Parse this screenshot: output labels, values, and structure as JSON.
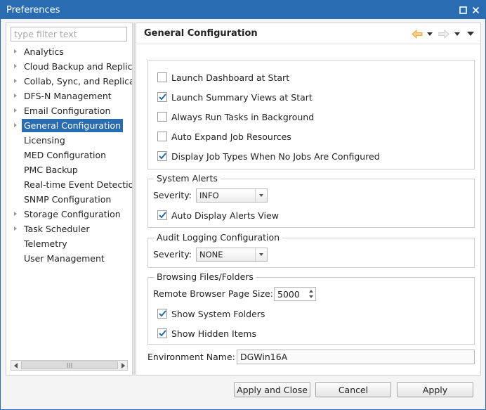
{
  "window": {
    "title": "Preferences"
  },
  "filter": {
    "placeholder": "type filter text",
    "value": ""
  },
  "tree": {
    "items": [
      {
        "label": "Analytics",
        "has_children": true
      },
      {
        "label": "Cloud Backup and Replic",
        "has_children": true
      },
      {
        "label": "Collab, Sync, and Replica",
        "has_children": true
      },
      {
        "label": "DFS-N Management",
        "has_children": true
      },
      {
        "label": "Email Configuration",
        "has_children": true
      },
      {
        "label": "General Configuration",
        "has_children": true,
        "selected": true
      },
      {
        "label": "Licensing",
        "has_children": false
      },
      {
        "label": "MED Configuration",
        "has_children": false
      },
      {
        "label": "PMC Backup",
        "has_children": false
      },
      {
        "label": "Real-time Event Detectio",
        "has_children": false
      },
      {
        "label": "SNMP Configuration",
        "has_children": false
      },
      {
        "label": "Storage Configuration",
        "has_children": true
      },
      {
        "label": "Task Scheduler",
        "has_children": true
      },
      {
        "label": "Telemetry",
        "has_children": false
      },
      {
        "label": "User Management",
        "has_children": false
      }
    ]
  },
  "page": {
    "title": "General Configuration",
    "nav_icons": [
      "back-arrow-icon",
      "dropdown-icon",
      "forward-arrow-icon",
      "dropdown-icon",
      "view-menu-icon"
    ]
  },
  "general": {
    "options": [
      {
        "label": "Launch Dashboard at Start",
        "checked": false
      },
      {
        "label": "Launch Summary Views at Start",
        "checked": true
      },
      {
        "label": "Always Run Tasks in Background",
        "checked": false
      },
      {
        "label": "Auto Expand Job Resources",
        "checked": false
      },
      {
        "label": "Display Job Types When No Jobs Are Configured",
        "checked": true
      }
    ]
  },
  "system_alerts": {
    "title": "System Alerts",
    "severity_label": "Severity:",
    "severity_value": "INFO",
    "auto_display_label": "Auto Display Alerts View",
    "auto_display_checked": true
  },
  "audit_logging": {
    "title": "Audit Logging Configuration",
    "severity_label": "Severity:",
    "severity_value": "NONE"
  },
  "browsing": {
    "title": "Browsing Files/Folders",
    "page_size_label": "Remote Browser Page Size:",
    "page_size_value": "5000",
    "show_system_label": "Show System Folders",
    "show_system_checked": true,
    "show_hidden_label": "Show Hidden Items",
    "show_hidden_checked": true
  },
  "environment": {
    "label": "Environment Name:",
    "value": "DGWin16A"
  },
  "buttons": {
    "apply_close": "Apply and Close",
    "cancel": "Cancel",
    "apply": "Apply"
  },
  "colors": {
    "accent": "#2a6cb2",
    "check": "#2a6cb2",
    "back_arrow": "#e8a33c"
  }
}
